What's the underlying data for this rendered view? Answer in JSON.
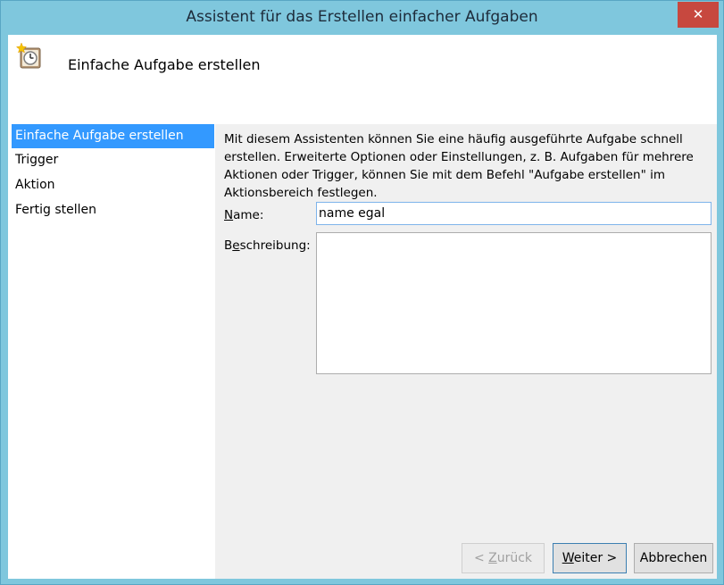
{
  "window": {
    "title": "Assistent für das Erstellen einfacher Aufgaben",
    "close_glyph": "✕"
  },
  "header": {
    "icon": "task-scheduler-clock-icon",
    "title": "Einfache Aufgabe erstellen"
  },
  "sidebar": {
    "items": [
      {
        "label": "Einfache Aufgabe erstellen",
        "active": true
      },
      {
        "label": "Trigger",
        "active": false
      },
      {
        "label": "Aktion",
        "active": false
      },
      {
        "label": "Fertig stellen",
        "active": false
      }
    ]
  },
  "main": {
    "description": "Mit diesem Assistenten können Sie eine häufig ausgeführte Aufgabe schnell erstellen. Erweiterte Optionen oder Einstellungen, z. B. Aufgaben für mehrere Aktionen oder Trigger, können Sie mit dem Befehl \"Aufgabe erstellen\" im Aktionsbereich festlegen.",
    "name_label_mnemonic": "N",
    "name_label_rest": "ame:",
    "name_value": "name egal",
    "description_label_first": "B",
    "description_label_mnemonic": "e",
    "description_label_rest": "schreibung:",
    "description_value": ""
  },
  "buttons": {
    "back_prefix": "< ",
    "back_mnemonic": "Z",
    "back_rest": "urück",
    "next_mnemonic": "W",
    "next_rest": "eiter >",
    "cancel": "Abbrechen"
  },
  "colors": {
    "accent": "#3399ff",
    "window_frame": "#7fc7dd",
    "close_button": "#c7483f"
  }
}
